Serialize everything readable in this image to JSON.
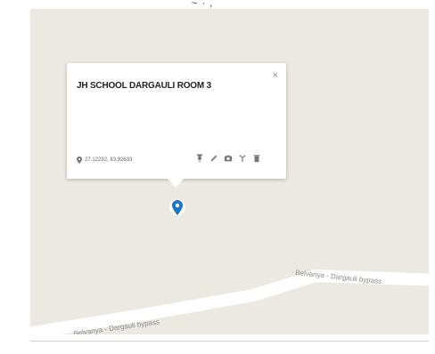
{
  "top_text": "~ · ,",
  "map": {
    "roads": [
      {
        "label": "Belvariya - Dargauli bypass"
      },
      {
        "label": "Belvariya - Dargauli bypass"
      }
    ]
  },
  "popup": {
    "title": "JH SCHOOL DARGAULI ROOM 3",
    "close_label": "×",
    "coordinates": "27.12292, 83.92633",
    "tools": [
      "pin-icon",
      "edit-icon",
      "camera-icon",
      "route-icon",
      "delete-icon"
    ]
  },
  "colors": {
    "map_background": "#ece9e2",
    "road": "#ffffff",
    "marker": "#1a73c8"
  }
}
